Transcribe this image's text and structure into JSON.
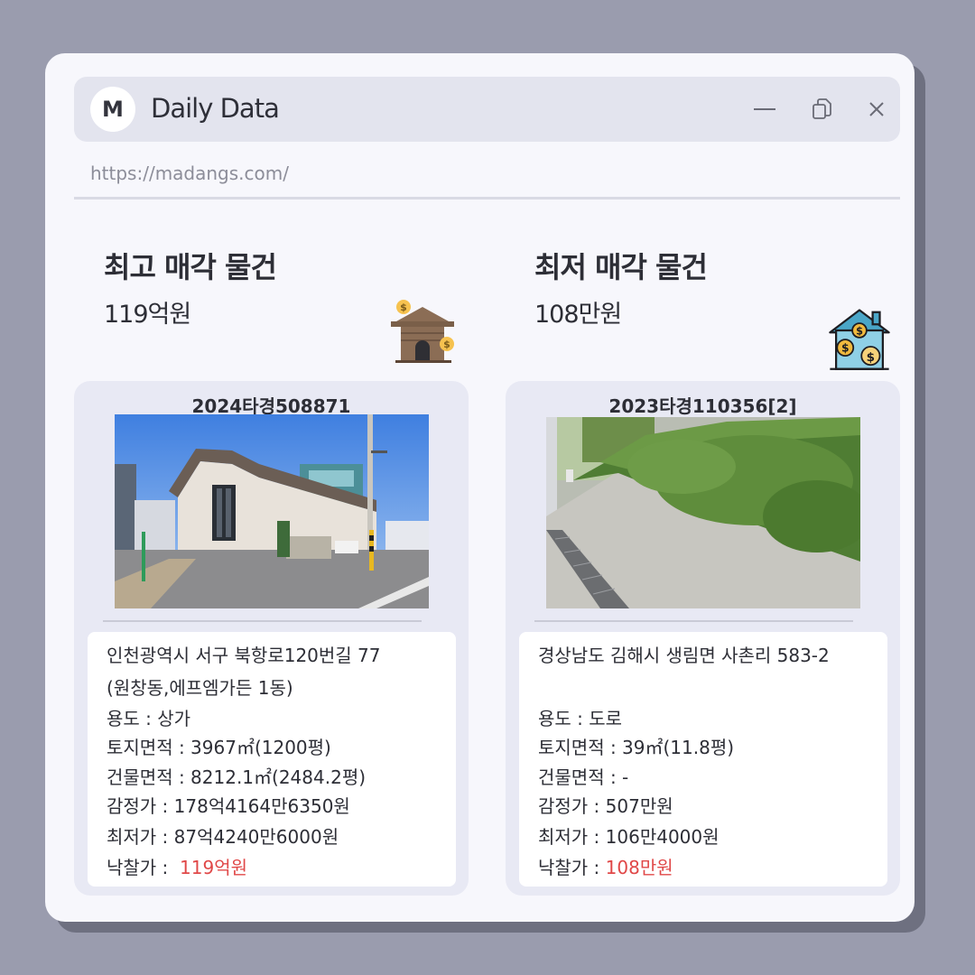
{
  "app": {
    "logo_letter": "M",
    "title": "Daily Data",
    "url": "https://madangs.com/"
  },
  "icons": {
    "minimize": "minimize-icon",
    "copy": "copy-window-icon",
    "close": "close-icon",
    "highest": "house-money-icon",
    "lowest": "house-coins-icon"
  },
  "colors": {
    "accent_red": "#e04848",
    "card_bg": "#e8e9f4",
    "window_bg": "#f7f7fc"
  },
  "highest": {
    "heading": "최고 매각 물건",
    "price": "119억원",
    "case_no": "2024타경508871",
    "address_1": "인천광역시 서구 북항로120번길 77",
    "address_2": "(원창동,에프엠가든 1동)",
    "usage": "용도 : 상가",
    "land_area": "토지면적 : 3967㎡(1200평)",
    "building_area": "건물면적 : 8212.1㎡(2484.2평)",
    "appraisal": "감정가 : 178억4164만6350원",
    "minimum": "최저가 : 87억4240만6000원",
    "winning_label": "낙찰가 :",
    "winning_value": "119억원"
  },
  "lowest": {
    "heading": "최저 매각 물건",
    "price": "108만원",
    "case_no": "2023타경110356[2]",
    "address_1": "경상남도 김해시 생림면 사촌리 583-2",
    "usage": "용도 :  도로",
    "land_area": "토지면적 : 39㎡(11.8평)",
    "building_area": "건물면적 : -",
    "appraisal": "감정가 : 507만원",
    "minimum": "최저가 : 106만4000원",
    "winning_label": "낙찰가 :",
    "winning_value": "108만원"
  }
}
